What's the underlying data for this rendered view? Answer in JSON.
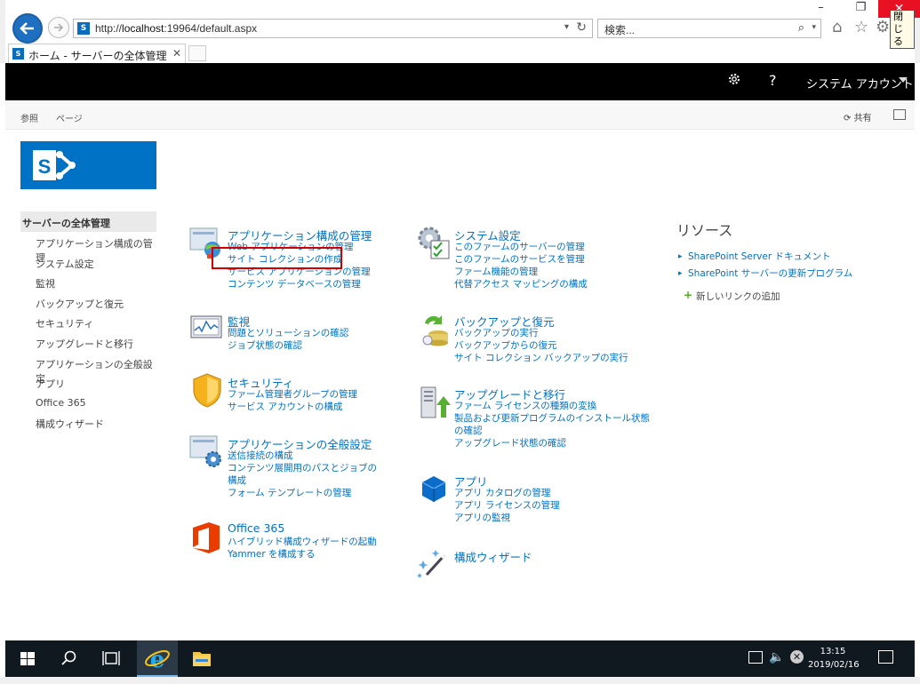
{
  "browser": {
    "url_prefix": "http://",
    "url_host": "localhost",
    "url_rest": ":19964/default.aspx",
    "search_placeholder": "検索...",
    "tab_title": "ホーム - サーバーの全体管理",
    "tooltip": "閉じる"
  },
  "suitebar": {
    "help": "?",
    "account": "システム アカウント"
  },
  "ribbon": {
    "tabs": [
      "参照",
      "ページ"
    ],
    "share": "共有"
  },
  "leftnav": {
    "heading": "サーバーの全体管理",
    "items": [
      "アプリケーション構成の管理",
      "システム設定",
      "監視",
      "バックアップと復元",
      "セキュリティ",
      "アップグレードと移行",
      "アプリケーションの全般設定",
      "アプリ",
      "Office 365",
      "構成ウィザード"
    ]
  },
  "sections": {
    "app_mgmt": {
      "title": "アプリケーション構成の管理",
      "links": [
        "Web アプリケーションの管理",
        "サイト コレクションの作成",
        "サービス アプリケーションの管理",
        "コンテンツ データベースの管理"
      ]
    },
    "monitoring": {
      "title": "監視",
      "links": [
        "問題とソリューションの確認",
        "ジョブ状態の確認"
      ]
    },
    "security": {
      "title": "セキュリティ",
      "links": [
        "ファーム管理者グループの管理",
        "サービス アカウントの構成"
      ]
    },
    "general": {
      "title": "アプリケーションの全般設定",
      "links": [
        "送信接続の構成",
        "コンテンツ展開用のパスとジョブの",
        "構成",
        "フォーム テンプレートの管理"
      ]
    },
    "office365": {
      "title": "Office 365",
      "links": [
        "ハイブリッド構成ウィザードの起動",
        "Yammer を構成する"
      ]
    },
    "system": {
      "title": "システム設定",
      "links": [
        "このファームのサーバーの管理",
        "このファームのサービスを管理",
        "ファーム機能の管理",
        "代替アクセス マッピングの構成"
      ]
    },
    "backup": {
      "title": "バックアップと復元",
      "links": [
        "バックアップの実行",
        "バックアップからの復元",
        "サイト コレクション バックアップの実行"
      ]
    },
    "upgrade": {
      "title": "アップグレードと移行",
      "links": [
        "ファーム ライセンスの種類の変換",
        "製品および更新プログラムのインストール状態",
        "の確認",
        "アップグレード状態の確認"
      ]
    },
    "apps": {
      "title": "アプリ",
      "links": [
        "アプリ カタログの管理",
        "アプリ ライセンスの管理",
        "アプリの監視"
      ]
    },
    "wizard": {
      "title": "構成ウィザード",
      "links": []
    }
  },
  "resources": {
    "title": "リソース",
    "links": [
      "SharePoint Server ドキュメント",
      "SharePoint サーバーの更新プログラム"
    ],
    "add_link": "新しいリンクの追加"
  },
  "taskbar": {
    "time": "13:15",
    "date": "2019/02/16"
  },
  "colors": {
    "accent": "#0072c6",
    "suitebar": "#000000",
    "highlight_box": "#d00000",
    "close": "#e81123"
  }
}
